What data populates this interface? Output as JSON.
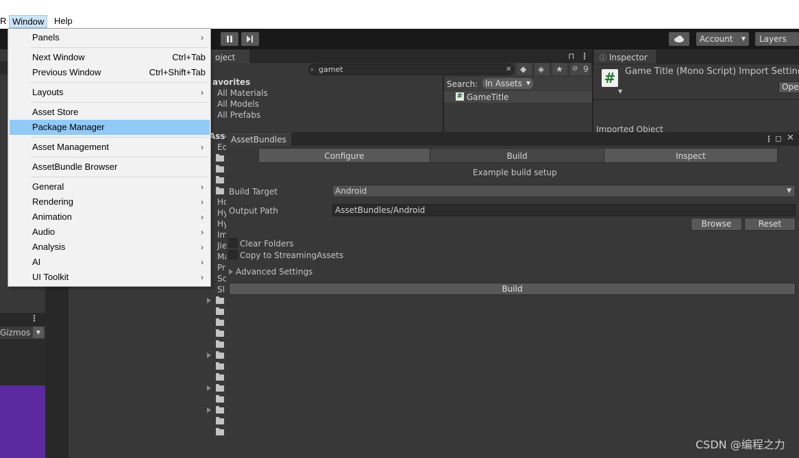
{
  "os_menubar": {
    "partial_item": "R",
    "window": "Window",
    "help": "Help"
  },
  "toolbar": {
    "account": "Account",
    "layers": "Layers"
  },
  "project": {
    "tab": "oject",
    "search_value": "gamet",
    "hidden_count": "9",
    "favorites": "avorites",
    "fav_items": [
      "All Materials",
      "All Models",
      "All Prefabs"
    ],
    "assets_header": "Asse",
    "search_label": "Search:",
    "search_scope": "In Assets",
    "result": "GameTitle",
    "tree_partials": [
      "Ed",
      "Ho",
      "Hy",
      "Hy",
      "Im",
      "Jie",
      "Ma",
      "Pr",
      "Sc",
      "Sl"
    ]
  },
  "scene": {
    "gizmos": "Gizmos"
  },
  "inspector": {
    "tab": "Inspector",
    "title": "Game Title (Mono Script) Import Settings",
    "open_btn": "Oper",
    "imported": "Imported Object"
  },
  "assetbundles": {
    "tab": "AssetBundles",
    "tabs": [
      "Configure",
      "Build",
      "Inspect"
    ],
    "subtitle": "Example build setup",
    "build_target_label": "Build Target",
    "build_target_value": "Android",
    "output_path_label": "Output Path",
    "output_path_value": "AssetBundles/Android",
    "browse": "Browse",
    "reset": "Reset",
    "clear_folders": "Clear Folders",
    "copy_streaming": "Copy to StreamingAssets",
    "advanced": "Advanced Settings",
    "build_btn": "Build"
  },
  "window_menu": {
    "items": [
      {
        "label": "Panels",
        "shortcut": "",
        "submenu": true
      },
      {
        "label": "Next Window",
        "shortcut": "Ctrl+Tab",
        "submenu": false
      },
      {
        "label": "Previous Window",
        "shortcut": "Ctrl+Shift+Tab",
        "submenu": false
      },
      {
        "label": "Layouts",
        "shortcut": "",
        "submenu": true
      },
      {
        "label": "Asset Store",
        "shortcut": "",
        "submenu": false
      },
      {
        "label": "Package Manager",
        "shortcut": "",
        "submenu": false
      },
      {
        "label": "Asset Management",
        "shortcut": "",
        "submenu": true
      },
      {
        "label": "AssetBundle Browser",
        "shortcut": "",
        "submenu": false
      },
      {
        "label": "General",
        "shortcut": "",
        "submenu": true
      },
      {
        "label": "Rendering",
        "shortcut": "",
        "submenu": true
      },
      {
        "label": "Animation",
        "shortcut": "",
        "submenu": true
      },
      {
        "label": "Audio",
        "shortcut": "",
        "submenu": true
      },
      {
        "label": "Analysis",
        "shortcut": "",
        "submenu": true
      },
      {
        "label": "AI",
        "shortcut": "",
        "submenu": true
      },
      {
        "label": "UI Toolkit",
        "shortcut": "",
        "submenu": true
      }
    ],
    "highlighted": "Package Manager",
    "arrow_glyph": "›"
  },
  "watermark": "CSDN @编程之力",
  "colors": {
    "highlight": "#91c9f7",
    "scene_purple": "#5b2aa0",
    "dark_bg": "#383838"
  }
}
